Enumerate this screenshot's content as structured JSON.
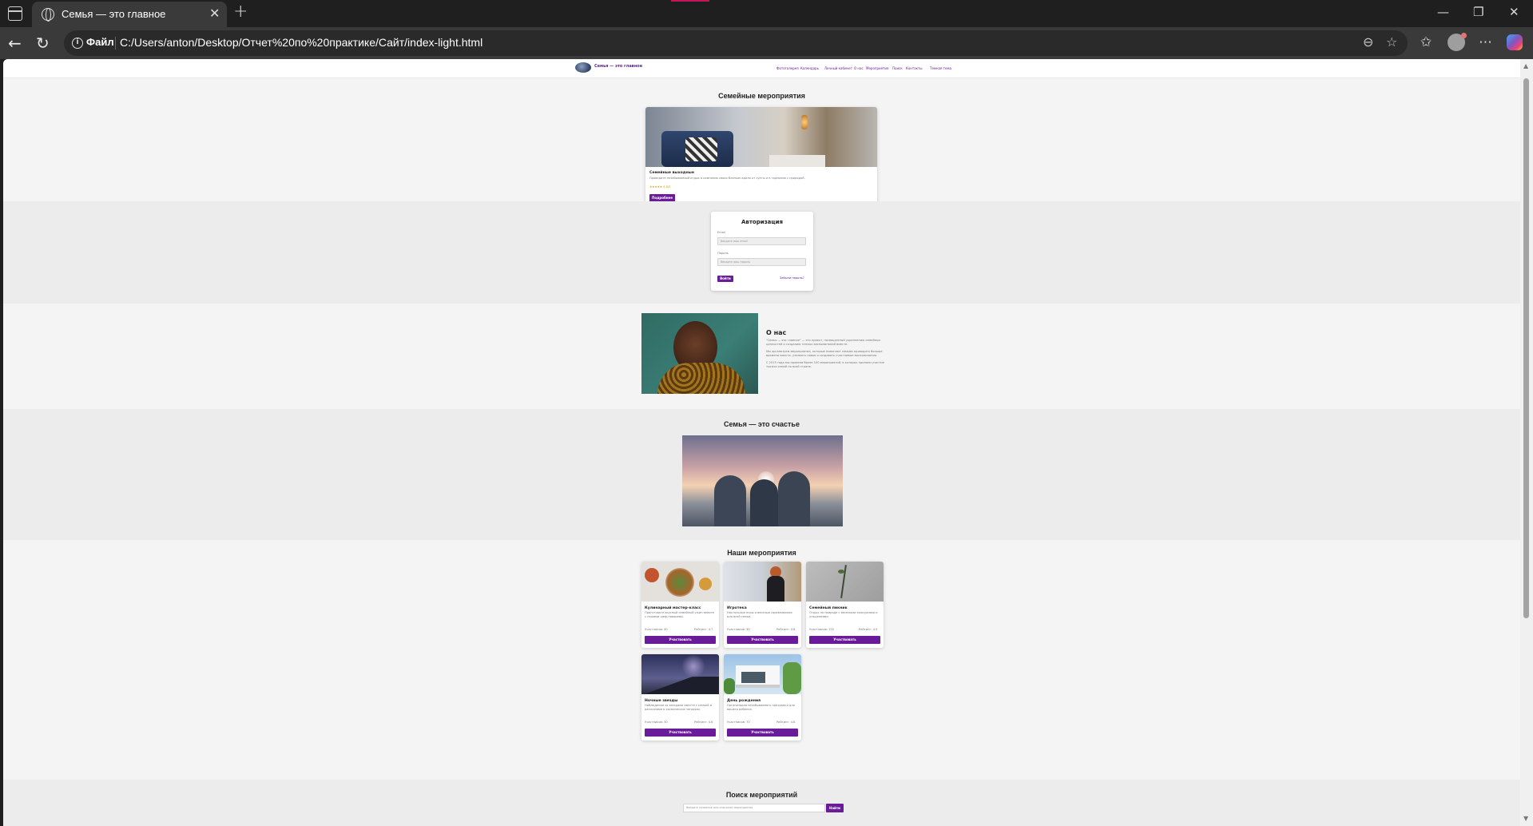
{
  "browser": {
    "tab_title": "Семья — это главное",
    "address_chip": "Файл",
    "url": "C:/Users/anton/Desktop/Отчет%20по%20практике/Сайт/index-light.html"
  },
  "site": {
    "logo_text": "Семья — это главное",
    "nav": [
      "Фотогалерея",
      "Календарь",
      "Личный кабинет",
      "О нас",
      "Мероприятия",
      "Поиск",
      "Контакты",
      "Темная тема"
    ]
  },
  "events_slider": {
    "title": "Семейные мероприятия",
    "card_title": "Семейные выходные",
    "card_desc": "Проведите незабываемый отдых в компании своих близких вдали от суеты и в гармонии с природой.",
    "rating": "★★★★★ 4.8/5",
    "button": "Подробнее"
  },
  "auth": {
    "title": "Авторизация",
    "email_label": "Email",
    "email_placeholder": "Введите ваш email",
    "password_label": "Пароль",
    "password_placeholder": "Введите ваш пароль",
    "login_button": "Войти",
    "forgot_link": "Забыли пароль?"
  },
  "about": {
    "title": "О нас",
    "p1": "\"Семья — это главное\" — это проект, посвященный укреплению семейных ценностей и созданию теплых воспоминаний вместе.",
    "p2": "Мы организуем мероприятия, которые помогают семьям проводить больше времени вместе, узнавать новое и создавать счастливые воспоминания.",
    "p3": "С 2015 года мы провели более 100 мероприятий, в которых приняли участие тысячи семей по всей стране."
  },
  "happiness": {
    "title": "Семья — это счастье"
  },
  "our_events": {
    "title": "Наши мероприятия",
    "cards": [
      {
        "title": "Кулинарный мастер-класс",
        "desc": "Приготовьте вкусный семейный ужин вместе с нашими шеф-поварами.",
        "participants": "Участников: 40",
        "rating": "Рейтинг: 4.7",
        "button": "Участвовать"
      },
      {
        "title": "Игротека",
        "desc": "Настольные игры и веселые соревнования для всей семьи.",
        "participants": "Участников: 30",
        "rating": "Рейтинг: 4.8",
        "button": "Участвовать"
      },
      {
        "title": "Семейный пикник",
        "desc": "Отдых на природе с веселыми конкурсами и угощениями.",
        "participants": "Участников: 120",
        "rating": "Рейтинг: 4.9",
        "button": "Участвовать"
      },
      {
        "title": "Ночные звезды",
        "desc": "Наблюдение за звездами вместе с семьей и рассказами о космических загадках.",
        "participants": "Участников: 30",
        "rating": "Рейтинг: 4.6",
        "button": "Участвовать"
      },
      {
        "title": "День рождения",
        "desc": "Организация незабываемого праздника для вашего ребенка.",
        "participants": "Участников: 70",
        "rating": "Рейтинг: 4.8",
        "button": "Участвовать"
      }
    ]
  },
  "search": {
    "title": "Поиск мероприятий",
    "placeholder": "Введите название или описание мероприятия",
    "button": "Найти"
  },
  "colors": {
    "accent": "#6a1b9a",
    "page_bg": "#f4f4f4",
    "alt_bg": "#ececec"
  }
}
